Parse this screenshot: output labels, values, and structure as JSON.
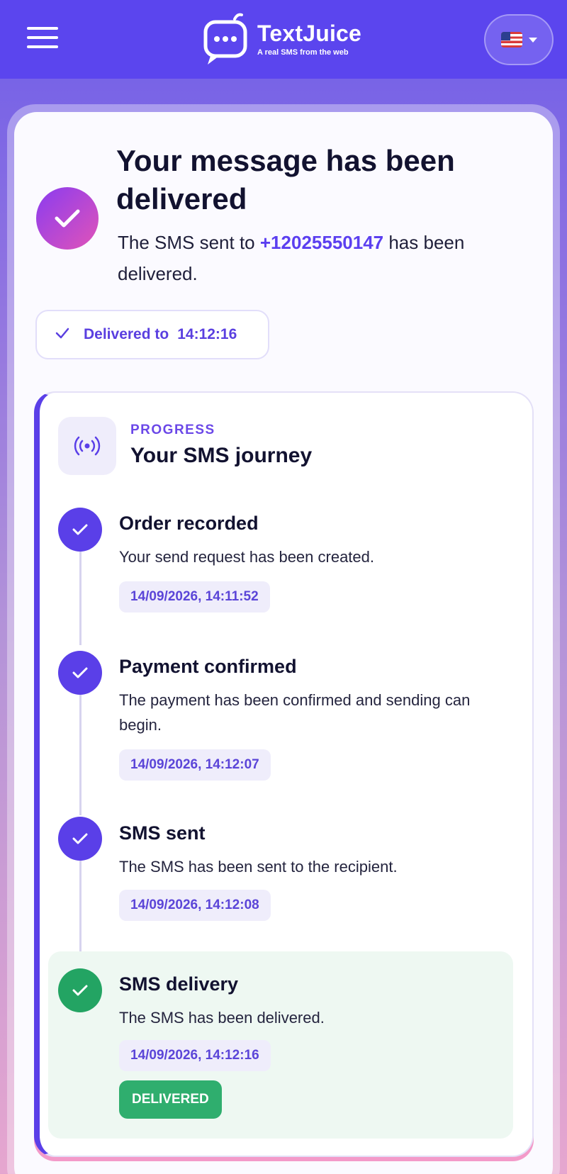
{
  "header": {
    "brand_name": "TextJuice",
    "brand_tagline": "A real SMS from the web",
    "language": "en-US"
  },
  "status": {
    "title": "Your message has been delivered",
    "subtitle_before": "The SMS sent to ",
    "phone": "+12025550147",
    "subtitle_after": " has been delivered.",
    "pill_label": "Delivered to",
    "pill_time": "14:12:16"
  },
  "progress": {
    "kicker": "PROGRESS",
    "title": "Your SMS journey",
    "steps": [
      {
        "title": "Order recorded",
        "description": "Your send request has been created.",
        "timestamp": "14/09/2026, 14:11:52"
      },
      {
        "title": "Payment confirmed",
        "description": "The payment has been confirmed and sending can begin.",
        "timestamp": "14/09/2026, 14:12:07"
      },
      {
        "title": "SMS sent",
        "description": "The SMS has been sent to the recipient.",
        "timestamp": "14/09/2026, 14:12:08"
      },
      {
        "title": "SMS delivery",
        "description": "The SMS has been delivered.",
        "timestamp": "14/09/2026, 14:12:16",
        "badge": "DELIVERED"
      }
    ]
  },
  "colors": {
    "primary": "#5b45ee",
    "accent_gradient_start": "#8a3cf0",
    "accent_gradient_end": "#e153b8",
    "success": "#23a463"
  }
}
